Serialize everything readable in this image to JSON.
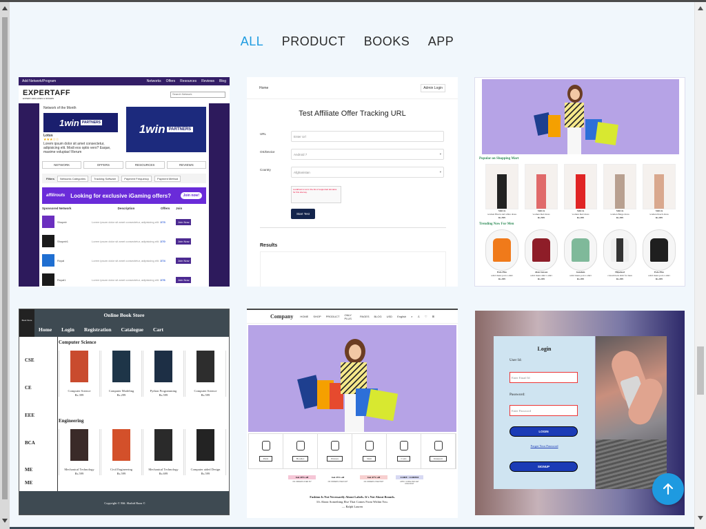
{
  "filters": {
    "items": [
      "ALL",
      "PRODUCT",
      "BOOKS",
      "APP"
    ],
    "active": "ALL"
  },
  "accent_color": "#1d9be0",
  "cards": {
    "expertaff": {
      "topbar_left": "Add Network/Program",
      "topbar_nav": [
        "Networks",
        "Offers",
        "Resources",
        "Reviews",
        "Blog"
      ],
      "logo": "EXPERTAFF",
      "tagline": "EXPERT AFFILIATES & OFFERS",
      "search_placeholder": "Search Network",
      "network_of_month": "Network of the Month",
      "brand": "1win",
      "brand_badge": "PARTNERS",
      "brand_name": "Lotus",
      "brand_desc": "Lorem ipsum dolor sit amet consectetur, adipisicing elit. Modi eos optio vero? Eaque, maxime voluptas! Rerum",
      "tabs": [
        "NETWORK",
        "OFFERS",
        "RESOURCES",
        "REVIEWS"
      ],
      "filters_label": "Filters",
      "filter_items": [
        "Networks Categories",
        "Tracking Software",
        "Payment Frequency",
        "Payment Method"
      ],
      "ad_brand": "affilirouts",
      "ad_text": "Looking for exclusive iGaming offers?",
      "ad_button": "Join now!",
      "table_headers": [
        "Sponsored Network",
        "Description",
        "Offers",
        "Join"
      ],
      "rows": [
        {
          "name": "Shopeir",
          "offers": "273",
          "join": "Join Now"
        },
        {
          "name": "Shopeir1",
          "offers": "270",
          "join": "Join Now"
        },
        {
          "name": "Royal",
          "offers": "274",
          "join": "Join Now"
        },
        {
          "name": "Royal1",
          "offers": "276",
          "join": "Join Now"
        }
      ],
      "row_desc": "Lorem ipsum dolor sit amet consectetur, adipisicing elit. Modi eos optio vero? Eaque, maxime voluptas!"
    },
    "tracking": {
      "nav_left": "Home",
      "nav_right": "Admin Login",
      "title": "Test Affiliate Offer Tracking URL",
      "url_label": "URL",
      "url_placeholder": "Enter Url",
      "os_label": "OS/Device",
      "os_value": "Android 7",
      "country_label": "Country",
      "country_value": "Afghanistan",
      "captcha_text": "Localhost is not in the list of supported domains for this site key.",
      "start_button": "Start Test",
      "results_label": "Results"
    },
    "fashion": {
      "section1": "Popular on Shopping Mart",
      "women": [
        {
          "name": "Saki-ia",
          "desc": "women Black and white dress",
          "price": "Rs.599"
        },
        {
          "name": "Saki-ia",
          "desc": "women Red dress",
          "price": "Rs.599"
        },
        {
          "name": "Saki-ia",
          "desc": "women Red dress",
          "price": "Rs.499"
        },
        {
          "name": "Saki-ia",
          "desc": "women Beige dress",
          "price": "Rs.499"
        },
        {
          "name": "Saki-ia",
          "desc": "women Peach dress",
          "price": "Rs.499"
        }
      ],
      "section2": "Trending Now For Men",
      "men": [
        {
          "name": "Polo Plus",
          "desc": "solid mens polo t-shirt",
          "price": "Rs.499"
        },
        {
          "name": "Alan Jonson",
          "desc": "solid mens shirt t-shirt",
          "price": "Rs.499"
        },
        {
          "name": "Gandem",
          "desc": "solid mens polo t-shirt",
          "price": "Rs.499"
        },
        {
          "name": "Hijacked",
          "desc": "colourblock shirt for men",
          "price": "Rs.499"
        },
        {
          "name": "Polo Plus",
          "desc": "solid mens polo t-shirt",
          "price": "Rs.499"
        }
      ]
    },
    "bookstore": {
      "title": "Online Book Store",
      "logo_text": "Book Store",
      "nav": [
        "Home",
        "Login",
        "Registration",
        "Catalogue",
        "Cart"
      ],
      "side_items": [
        "CSE",
        "CE",
        "EEE",
        "BCA",
        "ME",
        "ME"
      ],
      "section1": "Computer Science",
      "cs_books": [
        {
          "title": "Computer Science",
          "price": "Rs.399"
        },
        {
          "title": "Computer Modeling",
          "price": "Rs.299"
        },
        {
          "title": "Python Programming",
          "price": "Rs.599"
        },
        {
          "title": "Computer Science",
          "price": "Rs.599"
        }
      ],
      "section2": "Engineering",
      "eng_books": [
        {
          "title": "Mechanical Technology",
          "price": "Rs.599"
        },
        {
          "title": "Civil Engineering",
          "price": "Rs.599"
        },
        {
          "title": "Mechanical Technology",
          "price": "Rs.699"
        },
        {
          "title": "Computer aided Design",
          "price": "Rs.599"
        }
      ],
      "footer": "Copyright © Md. Shahid Raza ©"
    },
    "company": {
      "brand": "Company",
      "nav": [
        "HOME",
        "SHOP",
        "PRODUCT",
        "ONLY PLUS",
        "PAGES",
        "BLOG"
      ],
      "currency": "USD",
      "language": "English",
      "categories": [
        "Pants",
        "Hoodies",
        "Dresses",
        "Shirt",
        "Coats",
        "Innerpart"
      ],
      "offers": [
        {
          "label": "Get 20% off",
          "sub": "ON ORDERS OVER 50*",
          "color": "#f5c6d6"
        },
        {
          "label": "Get 25% off",
          "sub": "ON ORDERS OVER 100*",
          "color": "#ffffff"
        },
        {
          "label": "Get 47% off",
          "sub": "ON ORDERS OVER 500*",
          "color": "#f7cfcf"
        },
        {
          "label": "CODE : CODE10",
          "sub": "APPLY CODE AND GET DISCOUNT",
          "color": "#d7d9f3"
        }
      ],
      "quote1": "Fashion Is Not Necessarily About Labels. It's Not About Brands.",
      "quote2": "It's About Something Else That Comes From Within You.",
      "quote3": "— Ralph Lauren"
    },
    "login": {
      "title": "Login",
      "user_label": "User Id:",
      "user_placeholder": "Enter Email Id",
      "password_label": "Password:",
      "password_placeholder": "Enter Password",
      "login_button": "LOGIN",
      "forgot": "Forgot Your Password",
      "signup_button": "SIGNUP"
    }
  },
  "scroll_top_icon": "arrow-up-icon"
}
